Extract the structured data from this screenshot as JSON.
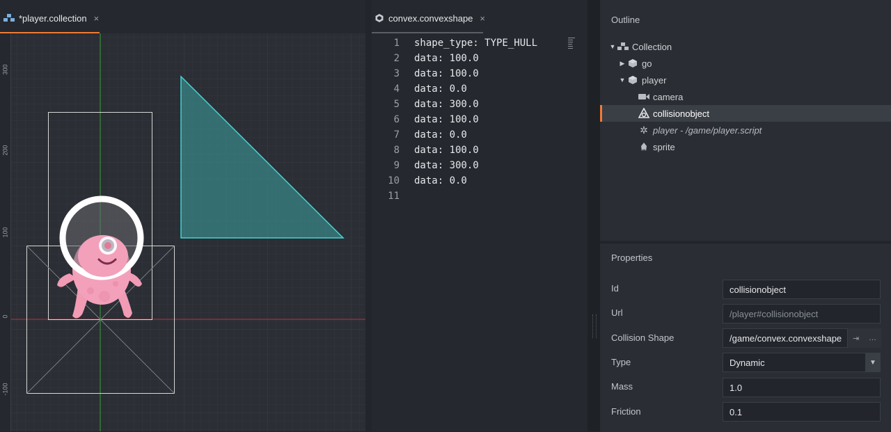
{
  "tabs": {
    "scene": {
      "label": "*player.collection",
      "close": "×",
      "accent": "#f07a35"
    },
    "code": {
      "label": "convex.convexshape",
      "close": "×"
    }
  },
  "scene": {
    "ruler_labels": [
      "300",
      "200",
      "100",
      "0",
      "-100"
    ],
    "colors": {
      "x_axis": "#c0303a",
      "y_axis": "#3aa33a",
      "hull_fill": "#3b9a9a",
      "hull_stroke": "#43d4d4"
    },
    "objects": [
      "player-sprite",
      "collision-hull-triangle",
      "sprite-bounds-box",
      "camera-bounds-box"
    ]
  },
  "code": {
    "lines": [
      {
        "n": "1",
        "text": "shape_type: TYPE_HULL"
      },
      {
        "n": "2",
        "text": "data: 100.0"
      },
      {
        "n": "3",
        "text": "data: 100.0"
      },
      {
        "n": "4",
        "text": "data: 0.0"
      },
      {
        "n": "5",
        "text": "data: 300.0"
      },
      {
        "n": "6",
        "text": "data: 100.0"
      },
      {
        "n": "7",
        "text": "data: 0.0"
      },
      {
        "n": "8",
        "text": "data: 100.0"
      },
      {
        "n": "9",
        "text": "data: 300.0"
      },
      {
        "n": "10",
        "text": "data: 0.0"
      },
      {
        "n": "11",
        "text": ""
      }
    ]
  },
  "outline": {
    "title": "Outline",
    "items": [
      {
        "label": "Collection",
        "icon": "collection-icon",
        "expanded": true
      },
      {
        "label": "go",
        "icon": "gameobject-icon",
        "expanded": false
      },
      {
        "label": "player",
        "icon": "gameobject-icon",
        "expanded": true
      },
      {
        "label": "camera",
        "icon": "camera-icon"
      },
      {
        "label": "collisionobject",
        "icon": "collisionobject-icon",
        "selected": true
      },
      {
        "label": "player - /game/player.script",
        "icon": "script-gear-icon"
      },
      {
        "label": "sprite",
        "icon": "sprite-icon"
      }
    ]
  },
  "properties": {
    "title": "Properties",
    "id": {
      "label": "Id",
      "value": "collisionobject"
    },
    "url": {
      "label": "Url",
      "value": "/player#collisionobject"
    },
    "collision_shape": {
      "label": "Collision Shape",
      "value": "/game/convex.convexshape",
      "btn1": "⇥",
      "btn2": "…"
    },
    "type": {
      "label": "Type",
      "value": "Dynamic",
      "arrow": "▼"
    },
    "mass": {
      "label": "Mass",
      "value": "1.0"
    },
    "friction": {
      "label": "Friction",
      "value": "0.1"
    }
  }
}
